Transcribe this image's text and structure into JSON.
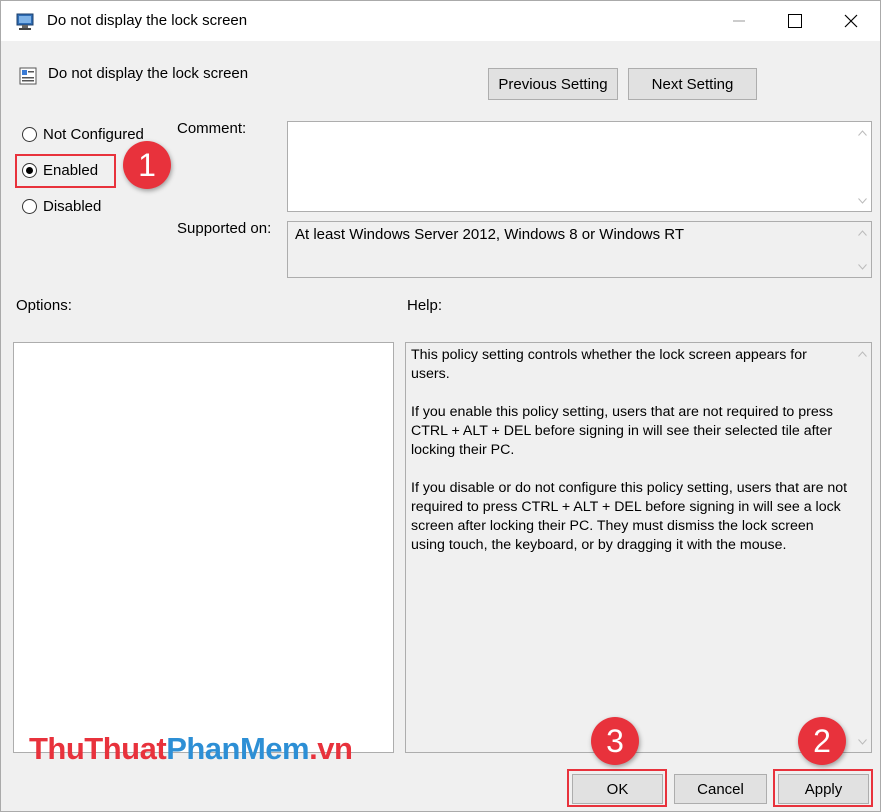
{
  "window": {
    "title": "Do not display the lock screen",
    "minimize_glyph": "—",
    "maximize_glyph": "☐",
    "close_glyph": "✕",
    "app_icon": "group-policy-icon"
  },
  "header": {
    "title": "Do not display the lock screen",
    "policy_icon": "policy-setting-icon",
    "previous_label": "Previous Setting",
    "next_label": "Next Setting"
  },
  "state": {
    "options": [
      {
        "label": "Not Configured",
        "checked": false
      },
      {
        "label": "Enabled",
        "checked": true
      },
      {
        "label": "Disabled",
        "checked": false
      }
    ]
  },
  "comment": {
    "label": "Comment:",
    "value": ""
  },
  "supported": {
    "label": "Supported on:",
    "value": "At least Windows Server 2012, Windows 8 or Windows RT"
  },
  "options_pane": {
    "label": "Options:"
  },
  "help": {
    "label": "Help:",
    "paragraphs": [
      "This policy setting controls whether the lock screen appears for users.",
      "If you enable this policy setting, users that are not required to press CTRL + ALT + DEL before signing in will see their selected tile after locking their PC.",
      "If you disable or do not configure this policy setting, users that are not required to press CTRL + ALT + DEL before signing in will see a lock screen after locking their PC. They must dismiss the lock screen using touch, the keyboard, or by dragging it with the mouse."
    ]
  },
  "footer": {
    "ok_label": "OK",
    "cancel_label": "Cancel",
    "apply_label": "Apply"
  },
  "annotations": {
    "step1": "1",
    "step2": "2",
    "step3": "3"
  },
  "watermark": {
    "part1": "ThuThuat",
    "part2": "PhanMem",
    "part3": ".vn"
  },
  "colors": {
    "accent": "#e8323c",
    "watermark_blue": "#2d8fd5",
    "dialog_bg": "#f0f0f0"
  }
}
